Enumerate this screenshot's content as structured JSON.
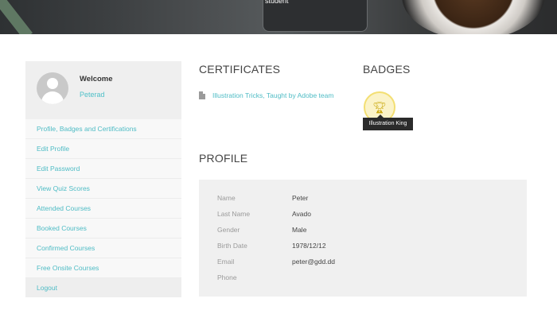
{
  "hero": {
    "caption": "student"
  },
  "user": {
    "greeting": "Welcome",
    "username": "Peterad"
  },
  "menu": [
    "Profile, Badges and Certifications",
    "Edit Profile",
    "Edit Password",
    "View Quiz Scores",
    "Attended Courses",
    "Booked Courses",
    "Confirmed Courses",
    "Free Onsite Courses",
    "Logout"
  ],
  "certificates": {
    "heading": "CERTIFICATES",
    "items": [
      "Illustration Tricks, Taught by Adobe team"
    ]
  },
  "badges": {
    "heading": "BADGES",
    "items": [
      {
        "name": "Illustration King",
        "icon": "trophy-icon",
        "color": "#f3df73"
      }
    ]
  },
  "profile": {
    "heading": "PROFILE",
    "fields": [
      {
        "label": "Name",
        "value": "Peter"
      },
      {
        "label": "Last Name",
        "value": "Avado"
      },
      {
        "label": "Gender",
        "value": "Male"
      },
      {
        "label": "Birth Date",
        "value": "1978/12/12"
      },
      {
        "label": "Email",
        "value": "peter@gdd.dd"
      },
      {
        "label": "Phone",
        "value": ""
      }
    ]
  },
  "colors": {
    "accent": "#4fbcc5",
    "panel": "#f0f0f0",
    "badge_ring": "#f3df73"
  }
}
